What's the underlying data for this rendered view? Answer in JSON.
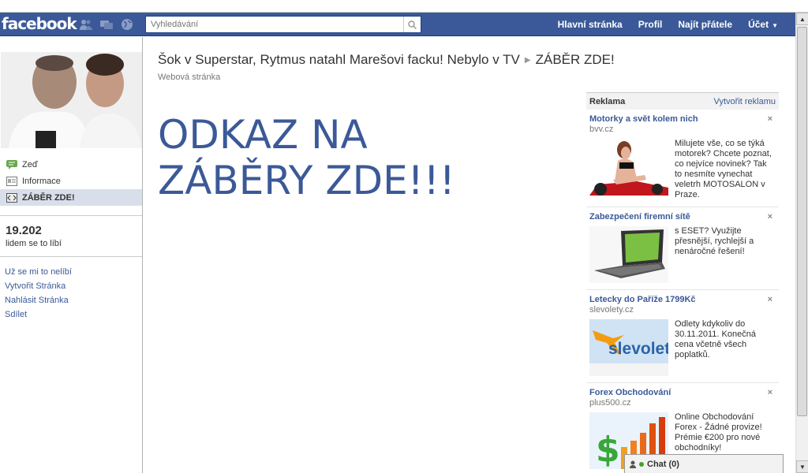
{
  "topbar": {
    "logo": "facebook",
    "search_placeholder": "Vyhledávání",
    "nav": [
      "Hlavní stránka",
      "Profil",
      "Najít přátele",
      "Účet"
    ]
  },
  "sidebar": {
    "menu": [
      {
        "label": "Zeď",
        "icon": "wall-icon"
      },
      {
        "label": "Informace",
        "icon": "info-icon"
      },
      {
        "label": "ZÁBĚR ZDE!",
        "icon": "tab-icon"
      }
    ],
    "likes_count": "19.202",
    "likes_label": "lidem se to líbí",
    "links": [
      "Už se mi to nelíbí",
      "Vytvořit Stránka",
      "Nahlásit Stránka",
      "Sdílet"
    ]
  },
  "main": {
    "page_title": "Šok v Superstar, Rytmus natahl Marešovi facku! Nebylo v TV",
    "tab_title": "ZÁBĚR ZDE!",
    "subtitle": "Webová stránka",
    "big_link": "ODKAZ NA ZÁBĚRY ZDE!!!"
  },
  "ads": {
    "header": "Reklama",
    "create_link": "Vytvořit reklamu",
    "items": [
      {
        "title": "Motorky a svět kolem nich",
        "domain": "bvv.cz",
        "text": "Milujete vše, co se týká motorek? Chcete poznat, co nejvíce novinek? Tak to nesmíte vynechat veletrh MOTOSALON v Praze.",
        "image": "motorcycle-model-image"
      },
      {
        "title": "Zabezpečení firemní sítě",
        "domain": "",
        "text": "s ESET? Využijte přesnější, rychlejší a nenáročné řešení!",
        "image": "laptop-image"
      },
      {
        "title": "Letecky do Paříže 1799Kč",
        "domain": "slevolety.cz",
        "text": "Odlety kdykoliv do 30.11.2011. Konečná cena včetně všech poplatků.",
        "image": "slevolety-logo-image",
        "logo_text": "slevolety"
      },
      {
        "title": "Forex Obchodování",
        "domain": "plus500.cz",
        "text": "Online Obchodování Forex - Žádné provize! Prémie €200 pro nové obchodníky!",
        "image": "dollar-chart-image"
      }
    ],
    "close_symbol": "×"
  },
  "chat": {
    "label": "Chat (0)"
  },
  "colors": {
    "brand": "#3b5998",
    "active_bg": "#d8dfea"
  }
}
